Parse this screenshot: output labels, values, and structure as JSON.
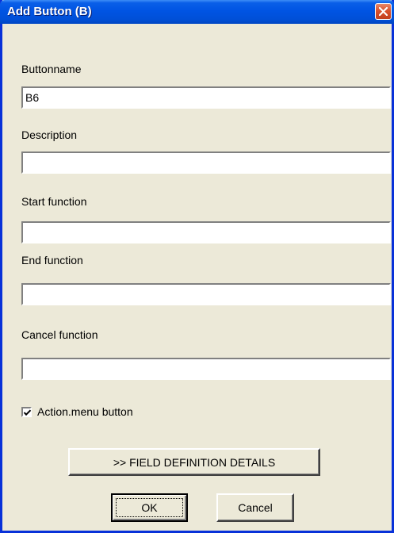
{
  "window": {
    "title": "Add Button (B)"
  },
  "form": {
    "buttonname_label": "Buttonname",
    "buttonname_value": "B6",
    "description_label": "Description",
    "description_value": "",
    "start_function_label": "Start function",
    "start_function_value": "",
    "end_function_label": "End function",
    "end_function_value": "",
    "cancel_function_label": "Cancel function",
    "cancel_function_value": "",
    "action_menu_label": "Action.menu button",
    "action_menu_checked": true
  },
  "buttons": {
    "field_details_label": ">> FIELD DEFINITION DETAILS",
    "ok_label": "OK",
    "cancel_label": "Cancel"
  },
  "icons": {
    "close": "close-icon",
    "checkmark": "checkmark-icon"
  },
  "colors": {
    "titlebar": "#0054e3",
    "face": "#ece9d8",
    "close": "#d9512d"
  }
}
